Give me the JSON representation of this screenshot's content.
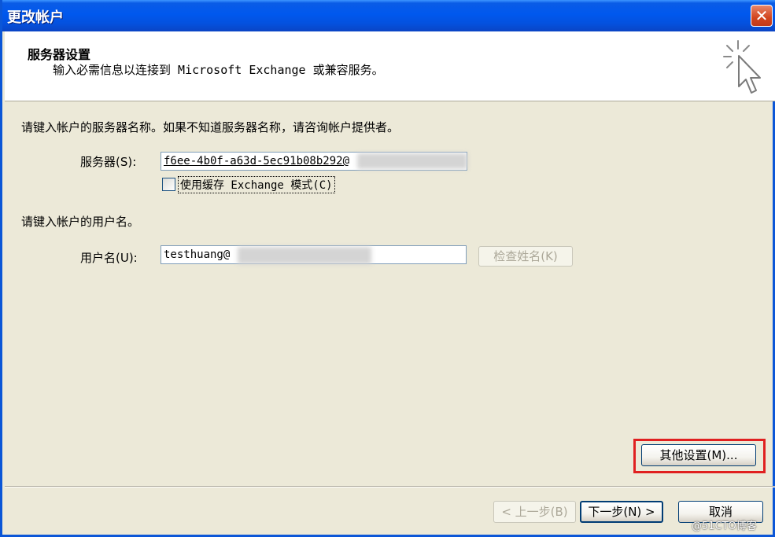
{
  "window": {
    "title": "更改帐户",
    "close_label": "✕"
  },
  "header": {
    "title": "服务器设置",
    "subtitle": "输入必需信息以连接到 Microsoft Exchange 或兼容服务。",
    "icon": "cursor-sparkle-icon"
  },
  "server_section": {
    "intro": "请键入帐户的服务器名称。如果不知道服务器名称，请咨询帐户提供者。",
    "server_label": "服务器(S):",
    "server_value": "f6ee-4b0f-a63d-5ec91b08b292@",
    "cached_mode_label": "使用缓存 Exchange 模式(C)",
    "cached_mode_checked": false
  },
  "user_section": {
    "intro": "请键入帐户的用户名。",
    "username_label": "用户名(U):",
    "username_value": "testhuang@",
    "check_name_button": "检查姓名(K)"
  },
  "more_settings_button": "其他设置(M)...",
  "footer": {
    "back_button": "< 上一步(B)",
    "next_button": "下一步(N) >",
    "cancel_button": "取消"
  },
  "watermark": "@51CTO博客",
  "colors": {
    "highlight": "#e02020",
    "titlebar": "#0058ee"
  }
}
